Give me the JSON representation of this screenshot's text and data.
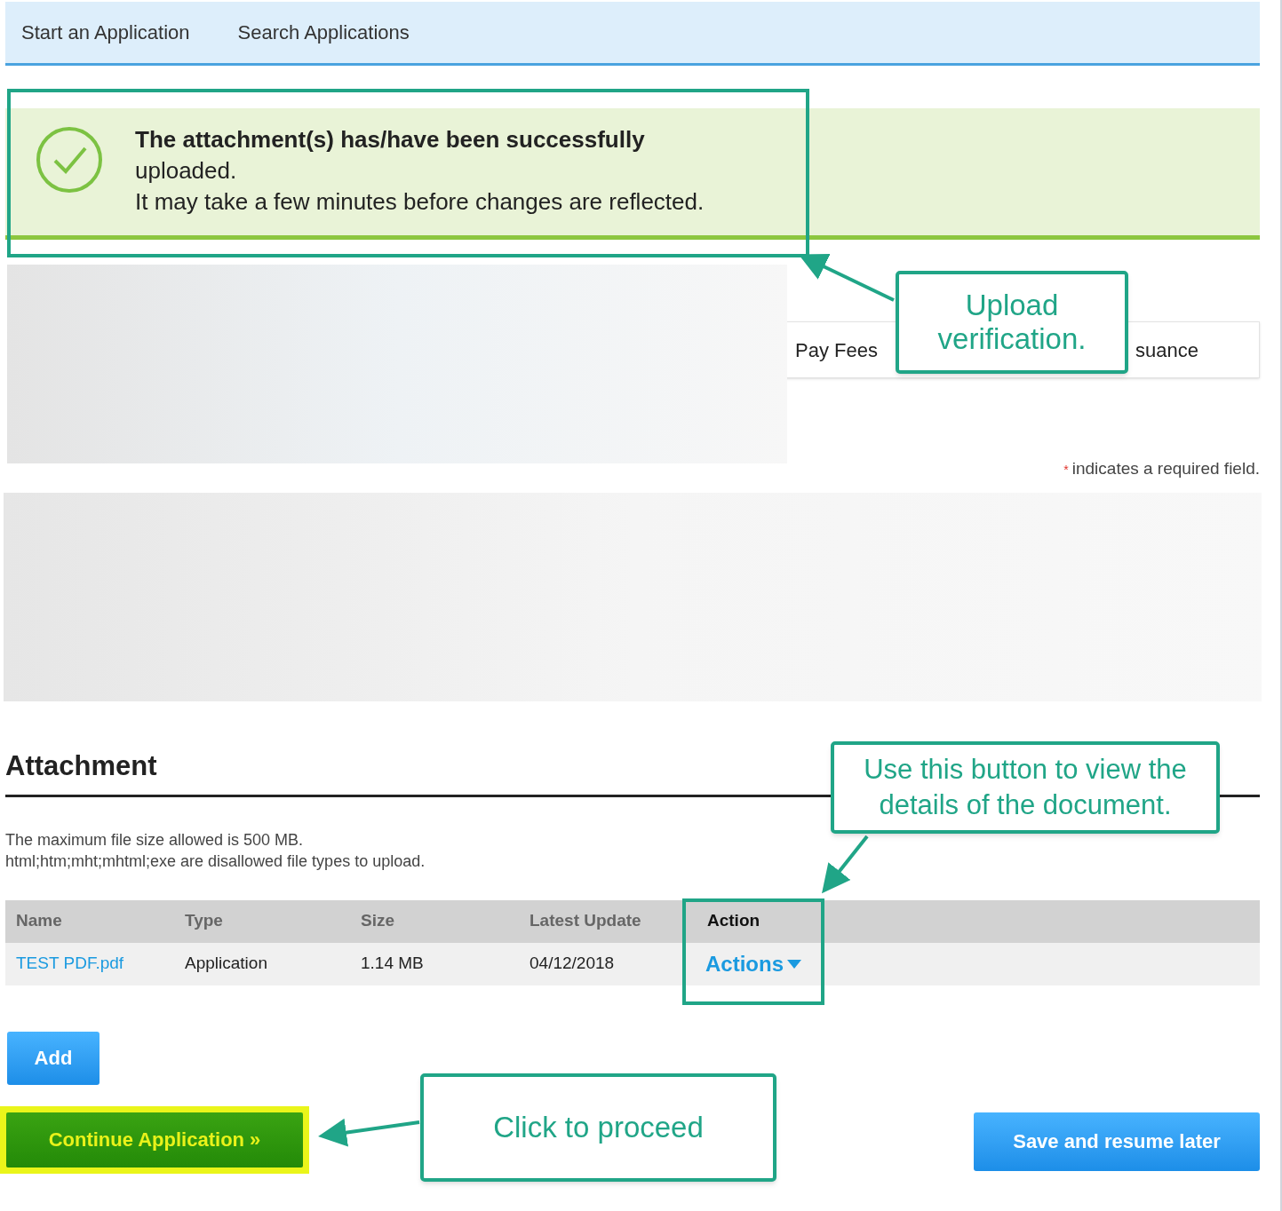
{
  "nav": {
    "items": [
      {
        "label": "Start an Application"
      },
      {
        "label": "Search Applications"
      }
    ]
  },
  "success_message": {
    "title": "The attachment(s) has/have been successfully",
    "lines": [
      "uploaded.",
      "It may take a few minutes before changes are reflected."
    ]
  },
  "steps": [
    "Pay Fees",
    "suance"
  ],
  "required_note": {
    "mark": "*",
    "text": "indicates a required field."
  },
  "attachment": {
    "heading": "Attachment",
    "notes": [
      "The maximum file size allowed is 500 MB.",
      "html;htm;mht;mhtml;exe are disallowed file types to upload."
    ],
    "columns": [
      "Name",
      "Type",
      "Size",
      "Latest Update",
      "Action"
    ],
    "rows": [
      {
        "cells": [
          "TEST PDF.pdf",
          "Application",
          "1.14 MB",
          "04/12/2018"
        ],
        "action": "Actions"
      }
    ]
  },
  "buttons": {
    "add": "Add",
    "continue": "Continue Application »",
    "save": "Save and resume later"
  },
  "callouts": [
    {
      "text": "Upload verification."
    },
    {
      "text": "Use this button to view the details of the document."
    },
    {
      "text": "Click to proceed"
    }
  ]
}
